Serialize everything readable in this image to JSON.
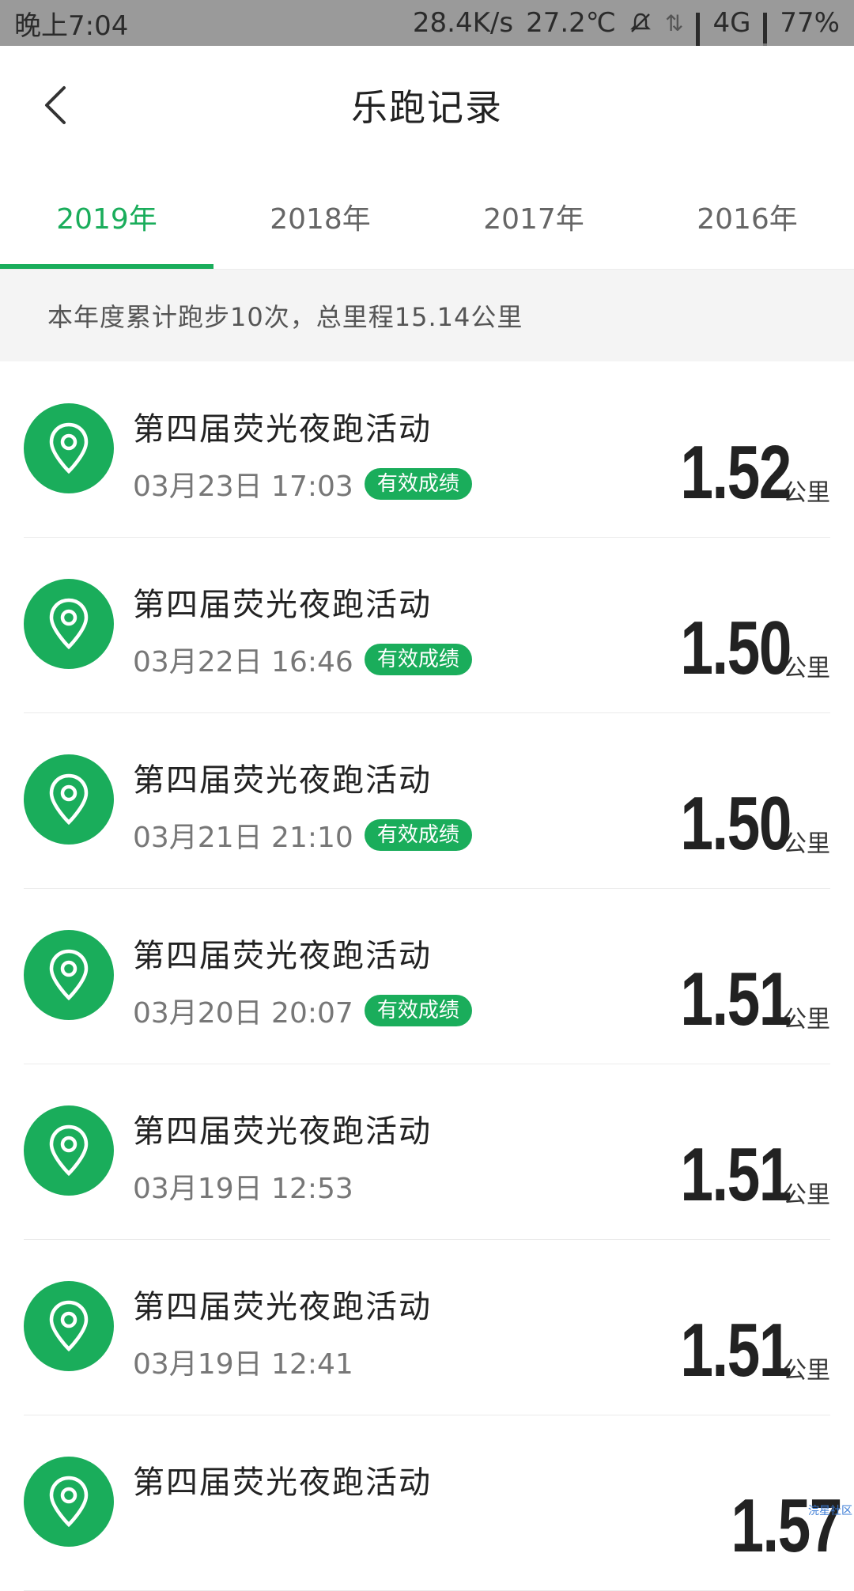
{
  "status_bar": {
    "time": "晚上7:04",
    "speed": "28.4K/s",
    "temp": "27.2℃",
    "network": "4G",
    "battery": "77%"
  },
  "header": {
    "title": "乐跑记录"
  },
  "tabs": [
    {
      "label": "2019年",
      "active": true
    },
    {
      "label": "2018年",
      "active": false
    },
    {
      "label": "2017年",
      "active": false
    },
    {
      "label": "2016年",
      "active": false
    }
  ],
  "summary": "本年度累计跑步10次，总里程15.14公里",
  "records": [
    {
      "title": "第四届荧光夜跑活动",
      "time": "03月23日 17:03",
      "badge": "有效成绩",
      "distance": "1.52",
      "unit": "公里"
    },
    {
      "title": "第四届荧光夜跑活动",
      "time": "03月22日 16:46",
      "badge": "有效成绩",
      "distance": "1.50",
      "unit": "公里"
    },
    {
      "title": "第四届荧光夜跑活动",
      "time": "03月21日 21:10",
      "badge": "有效成绩",
      "distance": "1.50",
      "unit": "公里"
    },
    {
      "title": "第四届荧光夜跑活动",
      "time": "03月20日 20:07",
      "badge": "有效成绩",
      "distance": "1.51",
      "unit": "公里"
    },
    {
      "title": "第四届荧光夜跑活动",
      "time": "03月19日 12:53",
      "badge": "",
      "distance": "1.51",
      "unit": "公里"
    },
    {
      "title": "第四届荧光夜跑活动",
      "time": "03月19日 12:41",
      "badge": "",
      "distance": "1.51",
      "unit": "公里"
    },
    {
      "title": "第四届荧光夜跑活动",
      "time": "",
      "badge": "",
      "distance": "1.57",
      "unit": ""
    }
  ],
  "watermark": "浣星社区",
  "colors": {
    "accent": "#1aad5b",
    "status_bar_bg": "#9a9a9a"
  }
}
